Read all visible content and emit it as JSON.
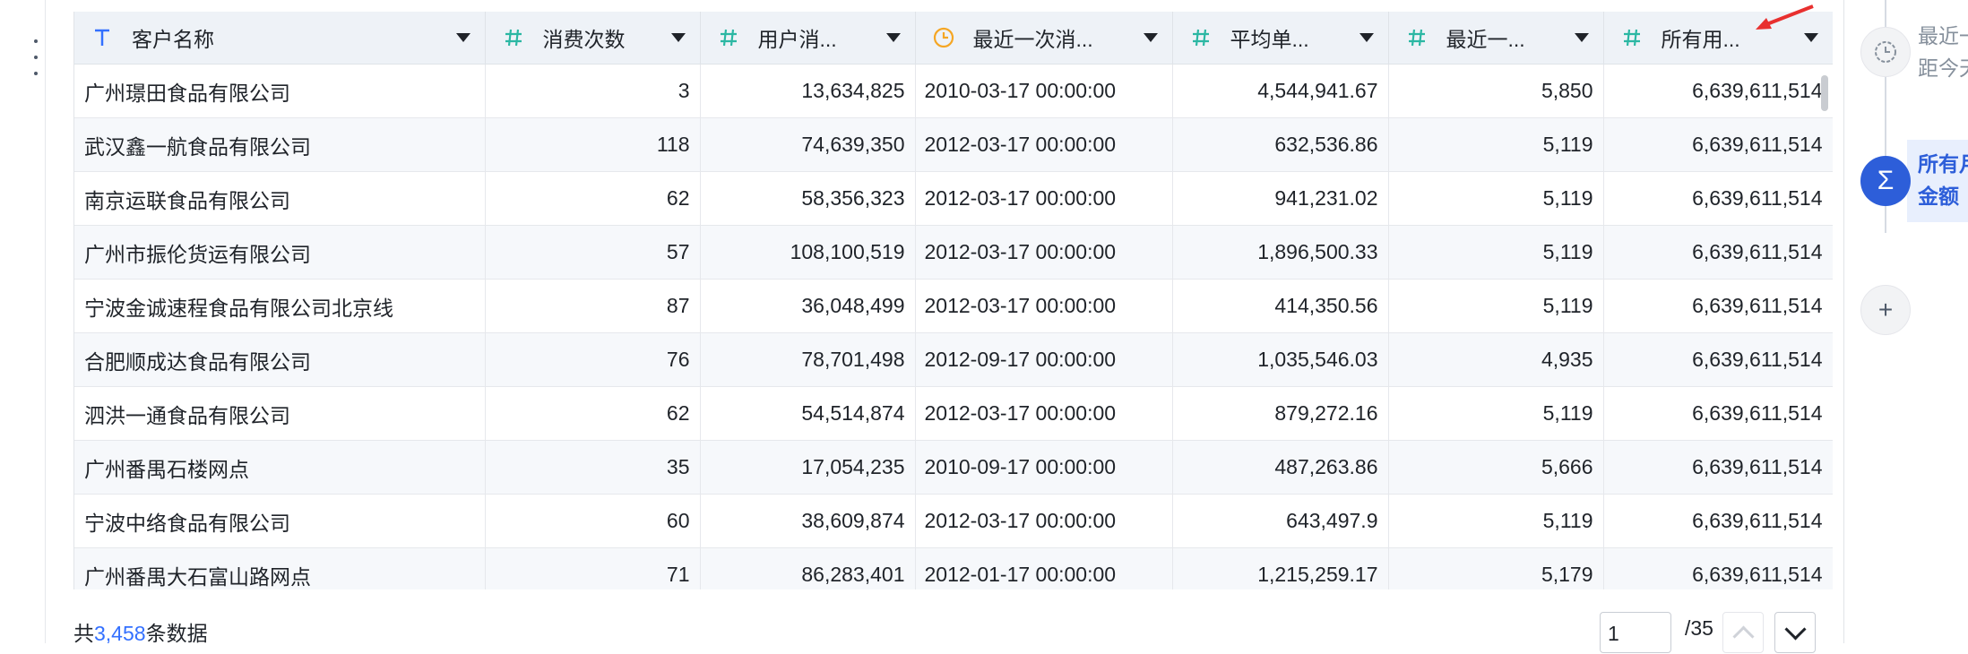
{
  "table": {
    "columns": [
      {
        "label": "客户名称",
        "type_icon": "text-type-icon"
      },
      {
        "label": "消费次数",
        "type_icon": "number-type-icon"
      },
      {
        "label": "用户消...",
        "type_icon": "number-type-icon"
      },
      {
        "label": "最近一次消...",
        "type_icon": "clock-type-icon"
      },
      {
        "label": "平均单...",
        "type_icon": "number-type-icon"
      },
      {
        "label": "最近一...",
        "type_icon": "number-type-icon"
      },
      {
        "label": "所有用...",
        "type_icon": "number-type-icon"
      }
    ],
    "rows": [
      [
        "广州璟田食品有限公司",
        "3",
        "13,634,825",
        "2010-03-17 00:00:00",
        "4,544,941.67",
        "5,850",
        "6,639,611,514"
      ],
      [
        "武汉鑫一航食品有限公司",
        "118",
        "74,639,350",
        "2012-03-17 00:00:00",
        "632,536.86",
        "5,119",
        "6,639,611,514"
      ],
      [
        "南京运联食品有限公司",
        "62",
        "58,356,323",
        "2012-03-17 00:00:00",
        "941,231.02",
        "5,119",
        "6,639,611,514"
      ],
      [
        "广州市振伦货运有限公司",
        "57",
        "108,100,519",
        "2012-03-17 00:00:00",
        "1,896,500.33",
        "5,119",
        "6,639,611,514"
      ],
      [
        "宁波金诚速程食品有限公司北京线",
        "87",
        "36,048,499",
        "2012-03-17 00:00:00",
        "414,350.56",
        "5,119",
        "6,639,611,514"
      ],
      [
        "合肥顺成达食品有限公司",
        "76",
        "78,701,498",
        "2012-09-17 00:00:00",
        "1,035,546.03",
        "4,935",
        "6,639,611,514"
      ],
      [
        "泗洪一通食品有限公司",
        "62",
        "54,514,874",
        "2012-03-17 00:00:00",
        "879,272.16",
        "5,119",
        "6,639,611,514"
      ],
      [
        "广州番禺石楼网点",
        "35",
        "17,054,235",
        "2010-09-17 00:00:00",
        "487,263.86",
        "5,666",
        "6,639,611,514"
      ],
      [
        "宁波中络食品有限公司",
        "60",
        "38,609,874",
        "2012-03-17 00:00:00",
        "643,497.9",
        "5,119",
        "6,639,611,514"
      ],
      [
        "广州番禺大石富山路网点",
        "71",
        "86,283,401",
        "2012-01-17 00:00:00",
        "1,215,259.17",
        "5,179",
        "6,639,611,514"
      ]
    ]
  },
  "footer": {
    "total_prefix": "共",
    "total_count": "3,458",
    "total_suffix": "条数据",
    "page_value": "1",
    "page_total": "/35"
  },
  "sidebar": {
    "step1_line1": "最近一",
    "step1_line2": "距今天",
    "step2_line1": "所有月",
    "step2_line2": "金额"
  },
  "colors": {
    "accent": "#3370ff",
    "number_icon": "#2bb7a3",
    "clock_icon": "#f5a623",
    "annotation_arrow": "#e8302f"
  }
}
